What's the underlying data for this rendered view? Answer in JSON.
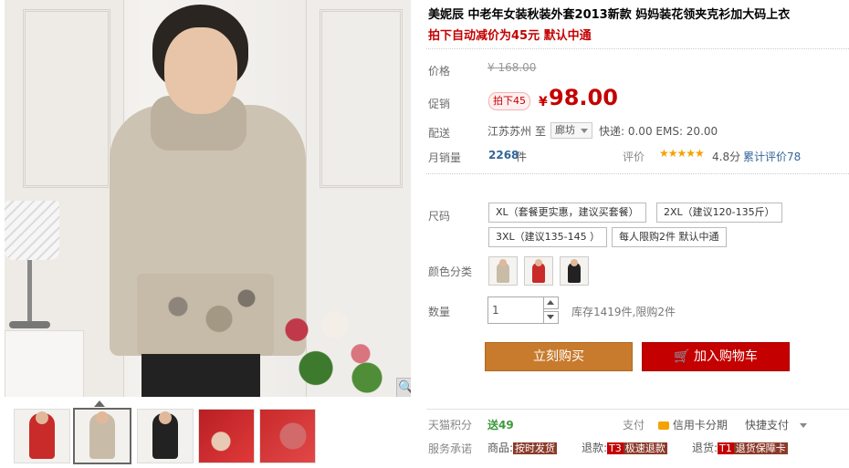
{
  "product": {
    "title": "美妮辰 中老年女装秋装外套2013新款 妈妈装花领夹克衫加大码上衣",
    "subtitle": "拍下自动减价为45元 默认中通"
  },
  "price": {
    "label": "价格",
    "original": "¥ 168.00"
  },
  "promo": {
    "label": "促销",
    "tag": "拍下45",
    "currency": "¥",
    "value": "98.00"
  },
  "shipping": {
    "label": "配送",
    "from": "江苏苏州",
    "to_word": "至",
    "destination": "廊坊",
    "fee": "快递: 0.00 EMS: 20.00"
  },
  "sales": {
    "label": "月销量",
    "count": "2268",
    "unit": "件",
    "rating_label": "评价",
    "stars": "★★★★★",
    "score": "4.8分",
    "reviews": "累计评价78"
  },
  "size": {
    "label": "尺码",
    "options": [
      "XL（套餐更实惠，建议买套餐）",
      "2XL（建议120-135斤）",
      "3XL（建议135-145 ）",
      "每人限购2件 默认中通"
    ]
  },
  "color": {
    "label": "颜色分类",
    "swatches": [
      "beige-jacket",
      "red-jacket",
      "black-jacket"
    ],
    "swatch_colors": [
      "#c8bca8",
      "#c92a2a",
      "#222222"
    ]
  },
  "quantity": {
    "label": "数量",
    "value": "1",
    "stock": "库存1419件,限购2件"
  },
  "actions": {
    "buy": "立刻购买",
    "cart": "加入购物车",
    "cart_icon": "🛒"
  },
  "tmall": {
    "points_label": "天猫积分",
    "points_value": "送49",
    "pay_label": "支付",
    "credit": "信用卡分期",
    "fast_pay": "快捷支付",
    "promise_label": "服务承诺",
    "goods_label": "商品:",
    "goods_tag": "按时发货",
    "refund_label": "退款:",
    "refund_code": "T3",
    "refund_tag": "极速退款",
    "return_label": "退货:",
    "return_code": "T1",
    "return_tag": "退货保障卡"
  },
  "thumbnails": [
    "red-jacket-photo",
    "beige-jacket-photo",
    "black-jacket-photo",
    "red-fabric-closeup",
    "red-pocket-closeup"
  ],
  "zoom_icon": "🔍",
  "colors": {
    "price_red": "#c40000",
    "buy_orange": "#c87b2d",
    "link_blue": "#336699",
    "star_gold": "#f4a200"
  }
}
